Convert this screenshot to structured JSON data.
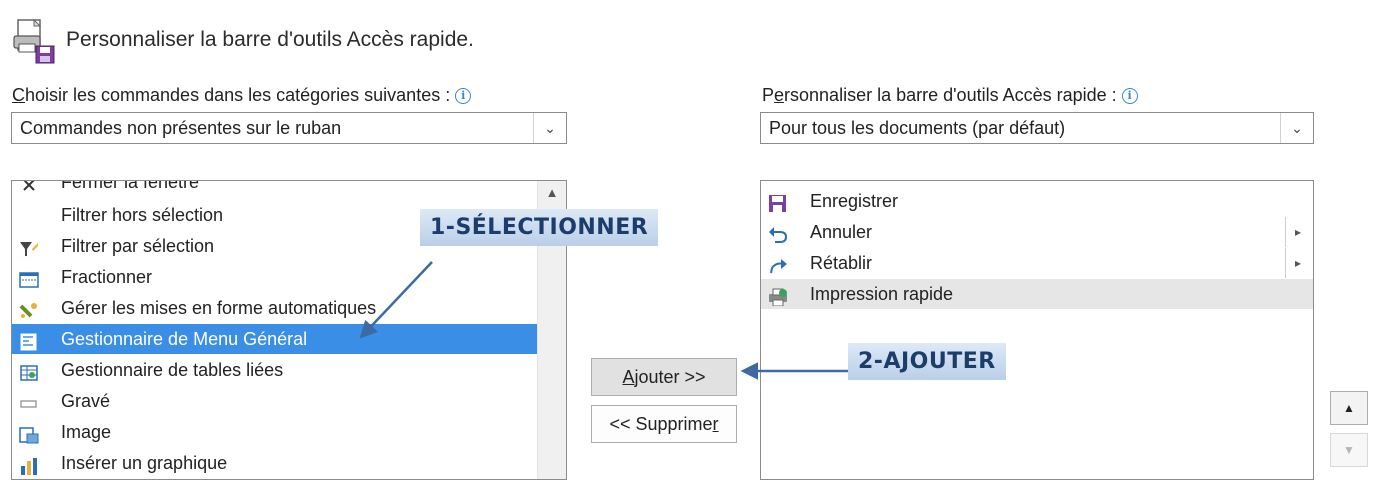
{
  "header": {
    "title": "Personnaliser la barre d'outils Accès rapide."
  },
  "left": {
    "label_first": "C",
    "label_rest": "hoisir les commandes dans les catégories suivantes :",
    "combo_value": "Commandes non présentes sur le ruban",
    "items": [
      {
        "label": "Fermer la fenêtre",
        "icon": "close-x-icon"
      },
      {
        "label": "Filtrer hors sélection",
        "icon": ""
      },
      {
        "label": "Filtrer par sélection",
        "icon": "filter-icon"
      },
      {
        "label": "Fractionner",
        "icon": "split-window-icon"
      },
      {
        "label": "Gérer les mises en forme automatiques",
        "icon": "autoformat-icon"
      },
      {
        "label": "Gestionnaire de Menu Général",
        "icon": "switchboard-icon",
        "selected": true
      },
      {
        "label": "Gestionnaire de tables liées",
        "icon": "linked-table-icon"
      },
      {
        "label": "Gravé",
        "icon": "engraved-icon"
      },
      {
        "label": "Image",
        "icon": "image-icon"
      },
      {
        "label": "Insérer un graphique",
        "icon": "chart-icon"
      }
    ]
  },
  "right": {
    "label_first": "P",
    "label_mid": "e",
    "label_rest": "rsonnaliser la barre d'outils Accès rapide :",
    "combo_value": "Pour tous les documents (par défaut)",
    "items": [
      {
        "label": "Enregistrer",
        "icon": "save-icon"
      },
      {
        "label": "Annuler",
        "icon": "undo-icon"
      },
      {
        "label": "Rétablir",
        "icon": "redo-icon"
      },
      {
        "label": "Impression rapide",
        "icon": "quick-print-icon",
        "highlighted": true
      }
    ]
  },
  "buttons": {
    "add_first": "A",
    "add_rest": "jouter >>",
    "remove_label": "<< Supprime",
    "remove_last": "r"
  },
  "callouts": {
    "select": "1-SÉLECTIONNER",
    "add": "2-AJOUTER"
  },
  "colors": {
    "selection": "#3a8ee6",
    "callout_text": "#1c3d6a",
    "arrow": "#3e6aa3"
  }
}
